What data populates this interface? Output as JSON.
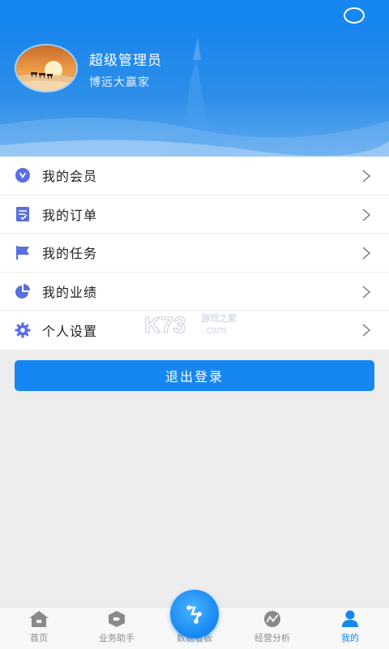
{
  "user": {
    "name": "超级管理员",
    "company": "博远大赢家"
  },
  "menu": {
    "items": [
      {
        "label": "我的会员",
        "icon": "member-icon"
      },
      {
        "label": "我的订单",
        "icon": "order-icon"
      },
      {
        "label": "我的任务",
        "icon": "flag-icon"
      },
      {
        "label": "我的业绩",
        "icon": "pie-chart-icon"
      },
      {
        "label": "个人设置",
        "icon": "gear-icon"
      }
    ]
  },
  "logout_label": "退出登录",
  "watermark": {
    "brand": "K73",
    "text": "游戏之家",
    "domain": ".com"
  },
  "tabs": [
    {
      "label": "首页",
      "icon": "home-icon"
    },
    {
      "label": "业务助手",
      "icon": "tag-icon"
    },
    {
      "label": "数据看板",
      "icon": "data-board-icon"
    },
    {
      "label": "经营分析",
      "icon": "analysis-icon"
    },
    {
      "label": "我的",
      "icon": "user-icon"
    }
  ],
  "colors": {
    "primary": "#1686f2",
    "icon": "#5b6fe0",
    "background": "#ededed"
  }
}
